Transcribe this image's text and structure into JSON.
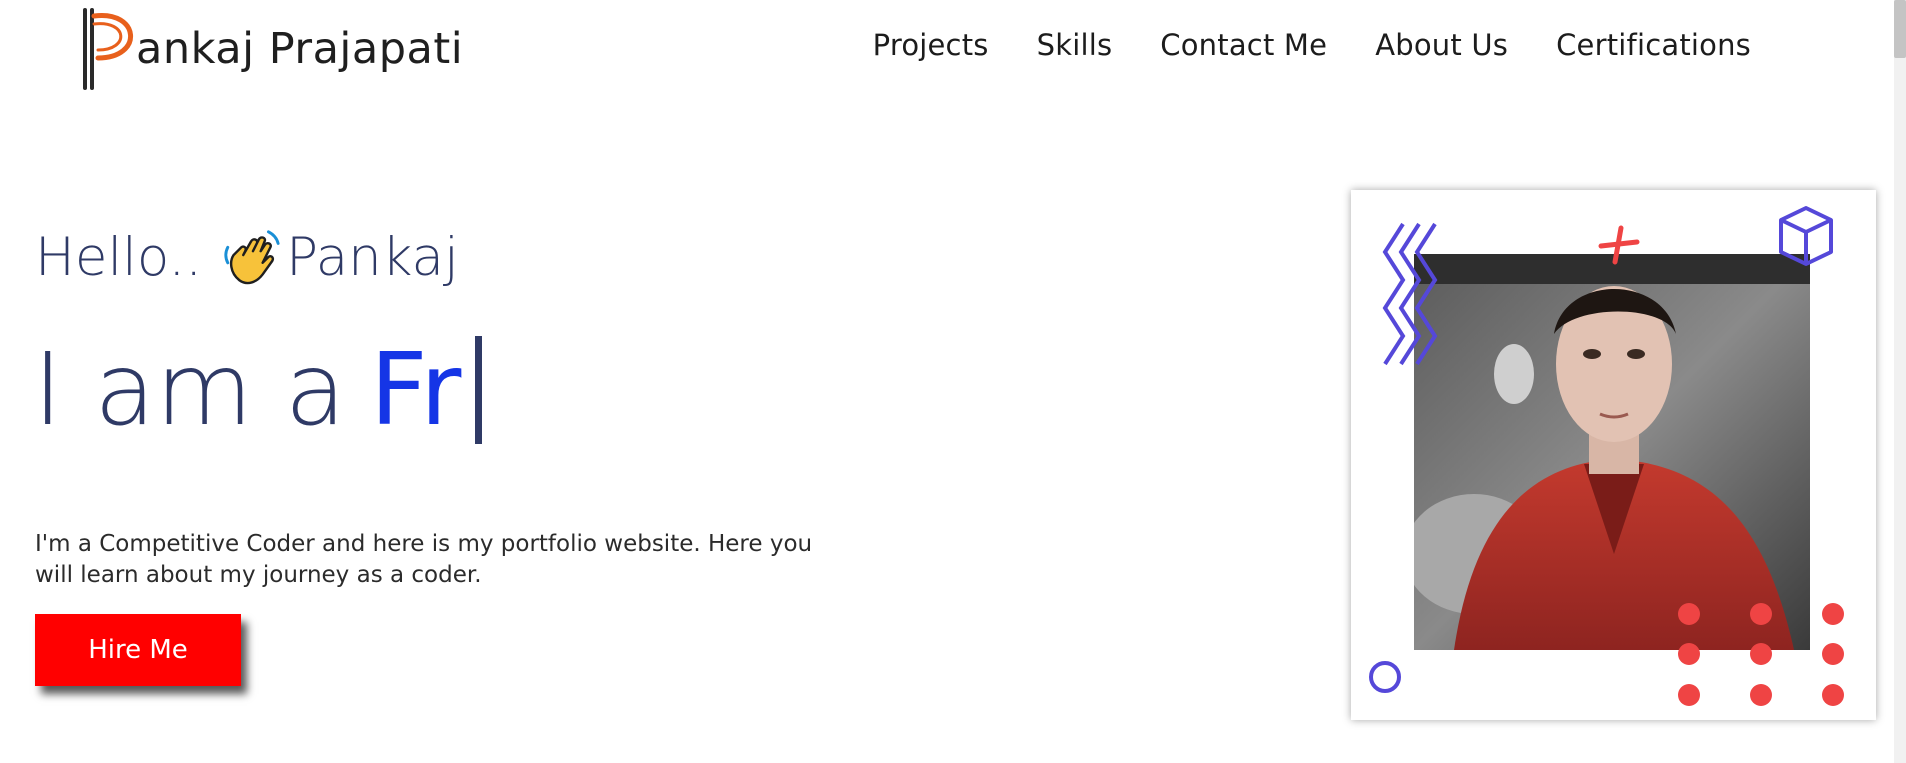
{
  "header": {
    "logo_initial": "P",
    "logo_text": "ankaj Prajapati",
    "nav": [
      {
        "label": "Projects"
      },
      {
        "label": "Skills"
      },
      {
        "label": "Contact Me"
      },
      {
        "label": "About Us"
      },
      {
        "label": "Certifications"
      }
    ]
  },
  "hero": {
    "greeting": "Hello..",
    "greeting_icon": "waving-hand-icon",
    "greeting_name": "Pankaj",
    "headline_prefix": "I am a",
    "headline_typed": "Fr",
    "intro": "I'm a Competitive Coder and here is my portfolio website. Here you will learn about my journey as a coder.",
    "cta_label": "Hire Me"
  },
  "colors": {
    "heading": "#2f3a66",
    "accent_blue": "#1535e6",
    "cta": "#ff0000",
    "deco_purple": "#5548d9",
    "deco_red": "#ef4444",
    "logo_orange": "#e8601c"
  }
}
